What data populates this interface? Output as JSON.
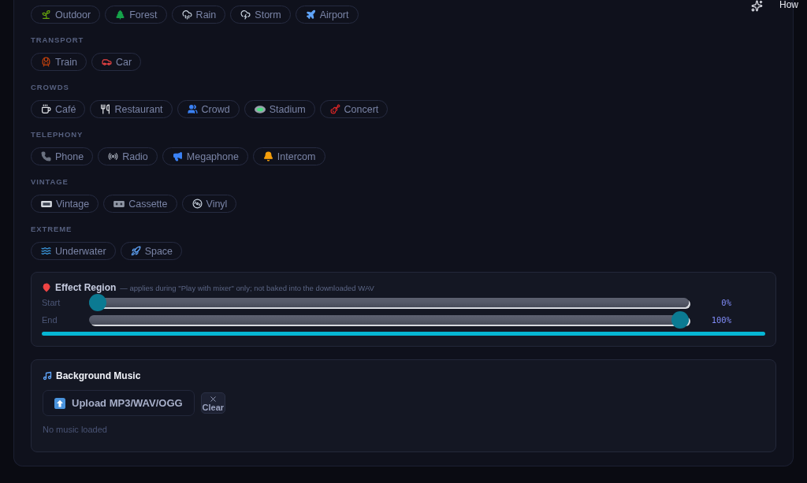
{
  "top_overlay": {
    "text": "How"
  },
  "effect_groups": [
    {
      "chips": [
        {
          "label": "Outdoor",
          "selected": false
        },
        {
          "label": "Forest",
          "selected": false
        },
        {
          "label": "Rain",
          "selected": false
        },
        {
          "label": "Storm",
          "selected": false
        },
        {
          "label": "Airport",
          "selected": false
        }
      ]
    },
    {
      "heading": "TRANSPORT",
      "chips": [
        {
          "label": "Train",
          "selected": false
        },
        {
          "label": "Car",
          "selected": false
        }
      ]
    },
    {
      "heading": "CROWDS",
      "chips": [
        {
          "label": "Café",
          "selected": false
        },
        {
          "label": "Restaurant",
          "selected": false
        },
        {
          "label": "Crowd",
          "selected": false
        },
        {
          "label": "Stadium",
          "selected": false
        },
        {
          "label": "Concert",
          "selected": false
        }
      ]
    },
    {
      "heading": "TELEPHONY",
      "chips": [
        {
          "label": "Phone",
          "selected": false
        },
        {
          "label": "Radio",
          "selected": false
        },
        {
          "label": "Megaphone",
          "selected": false
        },
        {
          "label": "Intercom",
          "selected": false
        }
      ]
    },
    {
      "heading": "VINTAGE",
      "chips": [
        {
          "label": "Vintage",
          "selected": false
        },
        {
          "label": "Cassette",
          "selected": false
        },
        {
          "label": "Vinyl",
          "selected": false
        }
      ]
    },
    {
      "heading": "EXTREME",
      "chips": [
        {
          "label": "Underwater",
          "selected": false
        },
        {
          "label": "Space",
          "selected": false
        }
      ]
    }
  ],
  "effect_region": {
    "title": "Effect Region",
    "note": "— applies during \"Play with mixer\" only; not baked into the downloaded WAV",
    "sliders": [
      {
        "label": "Start",
        "level": 0,
        "reading": "0%"
      },
      {
        "label": "End",
        "level": 1,
        "reading": "100%"
      }
    ]
  },
  "background_music": {
    "title": "Background Music",
    "upload_button": "Upload MP3/WAV/OGG",
    "clear_button": "Clear",
    "status": "No music loaded"
  }
}
